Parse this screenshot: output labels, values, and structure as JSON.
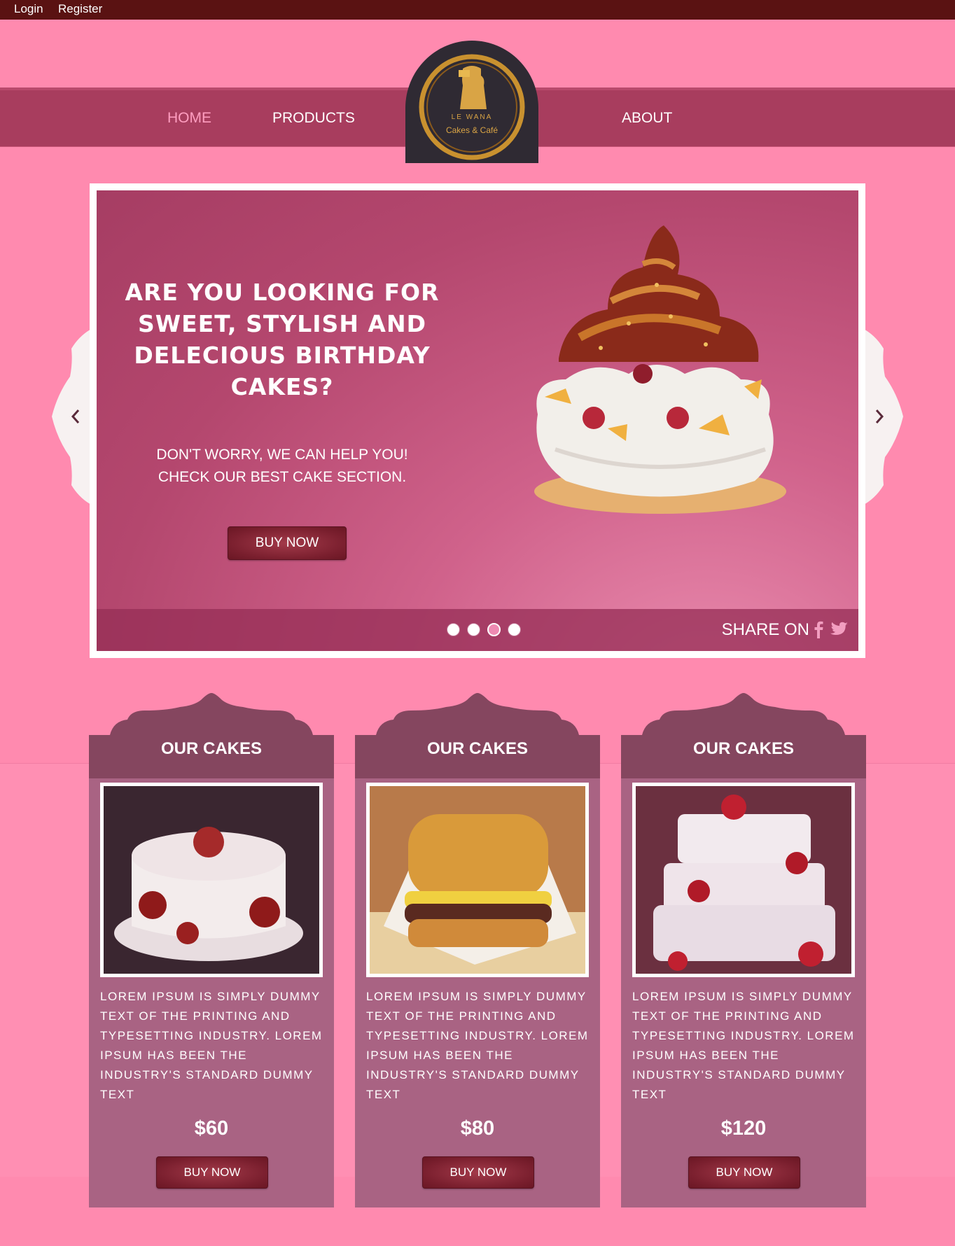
{
  "topbar": {
    "login": "Login",
    "register": "Register"
  },
  "nav": {
    "home": "HOME",
    "products": "PRODUCTS",
    "about": "ABOUT"
  },
  "logo": {
    "line1": "LE WANA",
    "line2": "Cakes & Café"
  },
  "slider": {
    "headline": "ARE YOU LOOKING FOR SWEET, STYLISH AND DELECIOUS BIRTHDAY CAKES?",
    "subtext_line1": "DON'T WORRY, WE CAN HELP YOU!",
    "subtext_line2": "CHECK OUR BEST CAKE SECTION.",
    "button": "BUY NOW",
    "share_label": "SHARE ON",
    "dots": 4,
    "active_dot": 3,
    "icons": [
      "chevron-left-icon",
      "chevron-right-icon",
      "facebook-icon",
      "twitter-icon"
    ]
  },
  "cards": [
    {
      "title": "OUR CAKES",
      "description": "LOREM IPSUM IS SIMPLY DUMMY TEXT OF THE PRINTING AND TYPESETTING INDUSTRY. LOREM IPSUM HAS BEEN THE INDUSTRY'S STANDARD DUMMY TEXT",
      "price": "$60",
      "button": "BUY NOW"
    },
    {
      "title": "OUR CAKES",
      "description": "LOREM IPSUM IS SIMPLY DUMMY TEXT OF THE PRINTING AND TYPESETTING INDUSTRY. LOREM IPSUM HAS BEEN THE INDUSTRY'S STANDARD DUMMY TEXT",
      "price": "$80",
      "button": "BUY NOW"
    },
    {
      "title": "OUR CAKES",
      "description": "LOREM IPSUM IS SIMPLY DUMMY TEXT OF THE PRINTING AND TYPESETTING INDUSTRY. LOREM IPSUM HAS BEEN THE INDUSTRY'S STANDARD DUMMY TEXT",
      "price": "$120",
      "button": "BUY NOW"
    }
  ],
  "colors": {
    "page_bg": "#ff8aaf",
    "topbar": "#5a1212",
    "nav_band": "#a83d5e",
    "card_header": "#85465f",
    "card_body": "#a96383",
    "button": "#7a1f2e"
  }
}
